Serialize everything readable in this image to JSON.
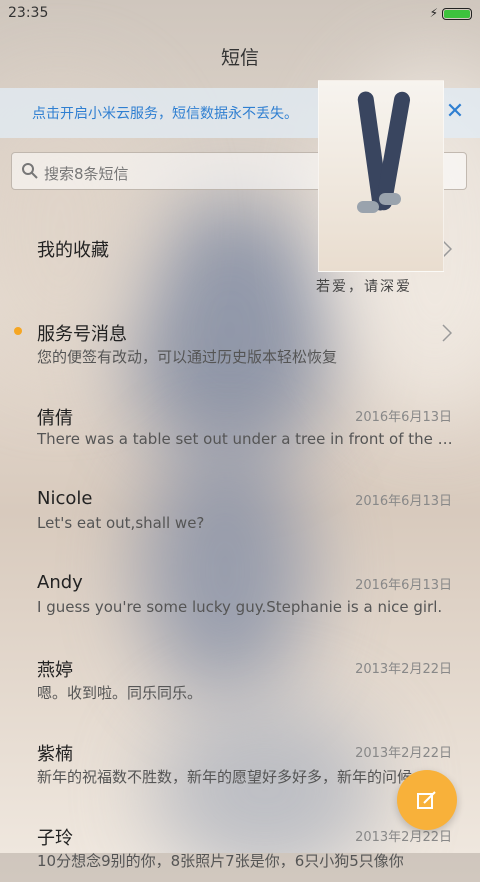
{
  "status_bar": {
    "time": "23:35"
  },
  "header": {
    "title": "短信"
  },
  "notice": {
    "text": "点击开启小米云服务，短信数据永不丢失。"
  },
  "photo": {
    "caption": "若爱，请深爱"
  },
  "search": {
    "placeholder": "搜索8条短信"
  },
  "items": [
    {
      "name": "我的收藏",
      "preview": "",
      "date": ""
    },
    {
      "name": "服务号消息",
      "preview": "您的便签有改动，可以通过历史版本轻松恢复",
      "date": ""
    },
    {
      "name": "倩倩",
      "preview": "There was a table set out under a tree in front of the ho...",
      "date": "2016年6月13日"
    },
    {
      "name": "Nicole",
      "preview": "Let's eat out,shall we?",
      "date": "2016年6月13日"
    },
    {
      "name": "Andy",
      "preview": "I guess you're some lucky guy.Stephanie is a nice girl.",
      "date": "2016年6月13日"
    },
    {
      "name": "燕婷",
      "preview": "嗯。收到啦。同乐同乐。",
      "date": "2013年2月22日"
    },
    {
      "name": "紫楠",
      "preview": "新年的祝福数不胜数，新年的愿望好多好多，新年的问候...",
      "date": "2013年2月22日"
    },
    {
      "name": "子玲",
      "preview": "10分想念9别的你，8张照片7张是你，6只小狗5只像你",
      "date": "2013年2月22日"
    }
  ],
  "colors": {
    "accent": "#2f7fd1",
    "fab": "#f8b13a",
    "unread_dot": "#f5a623"
  }
}
